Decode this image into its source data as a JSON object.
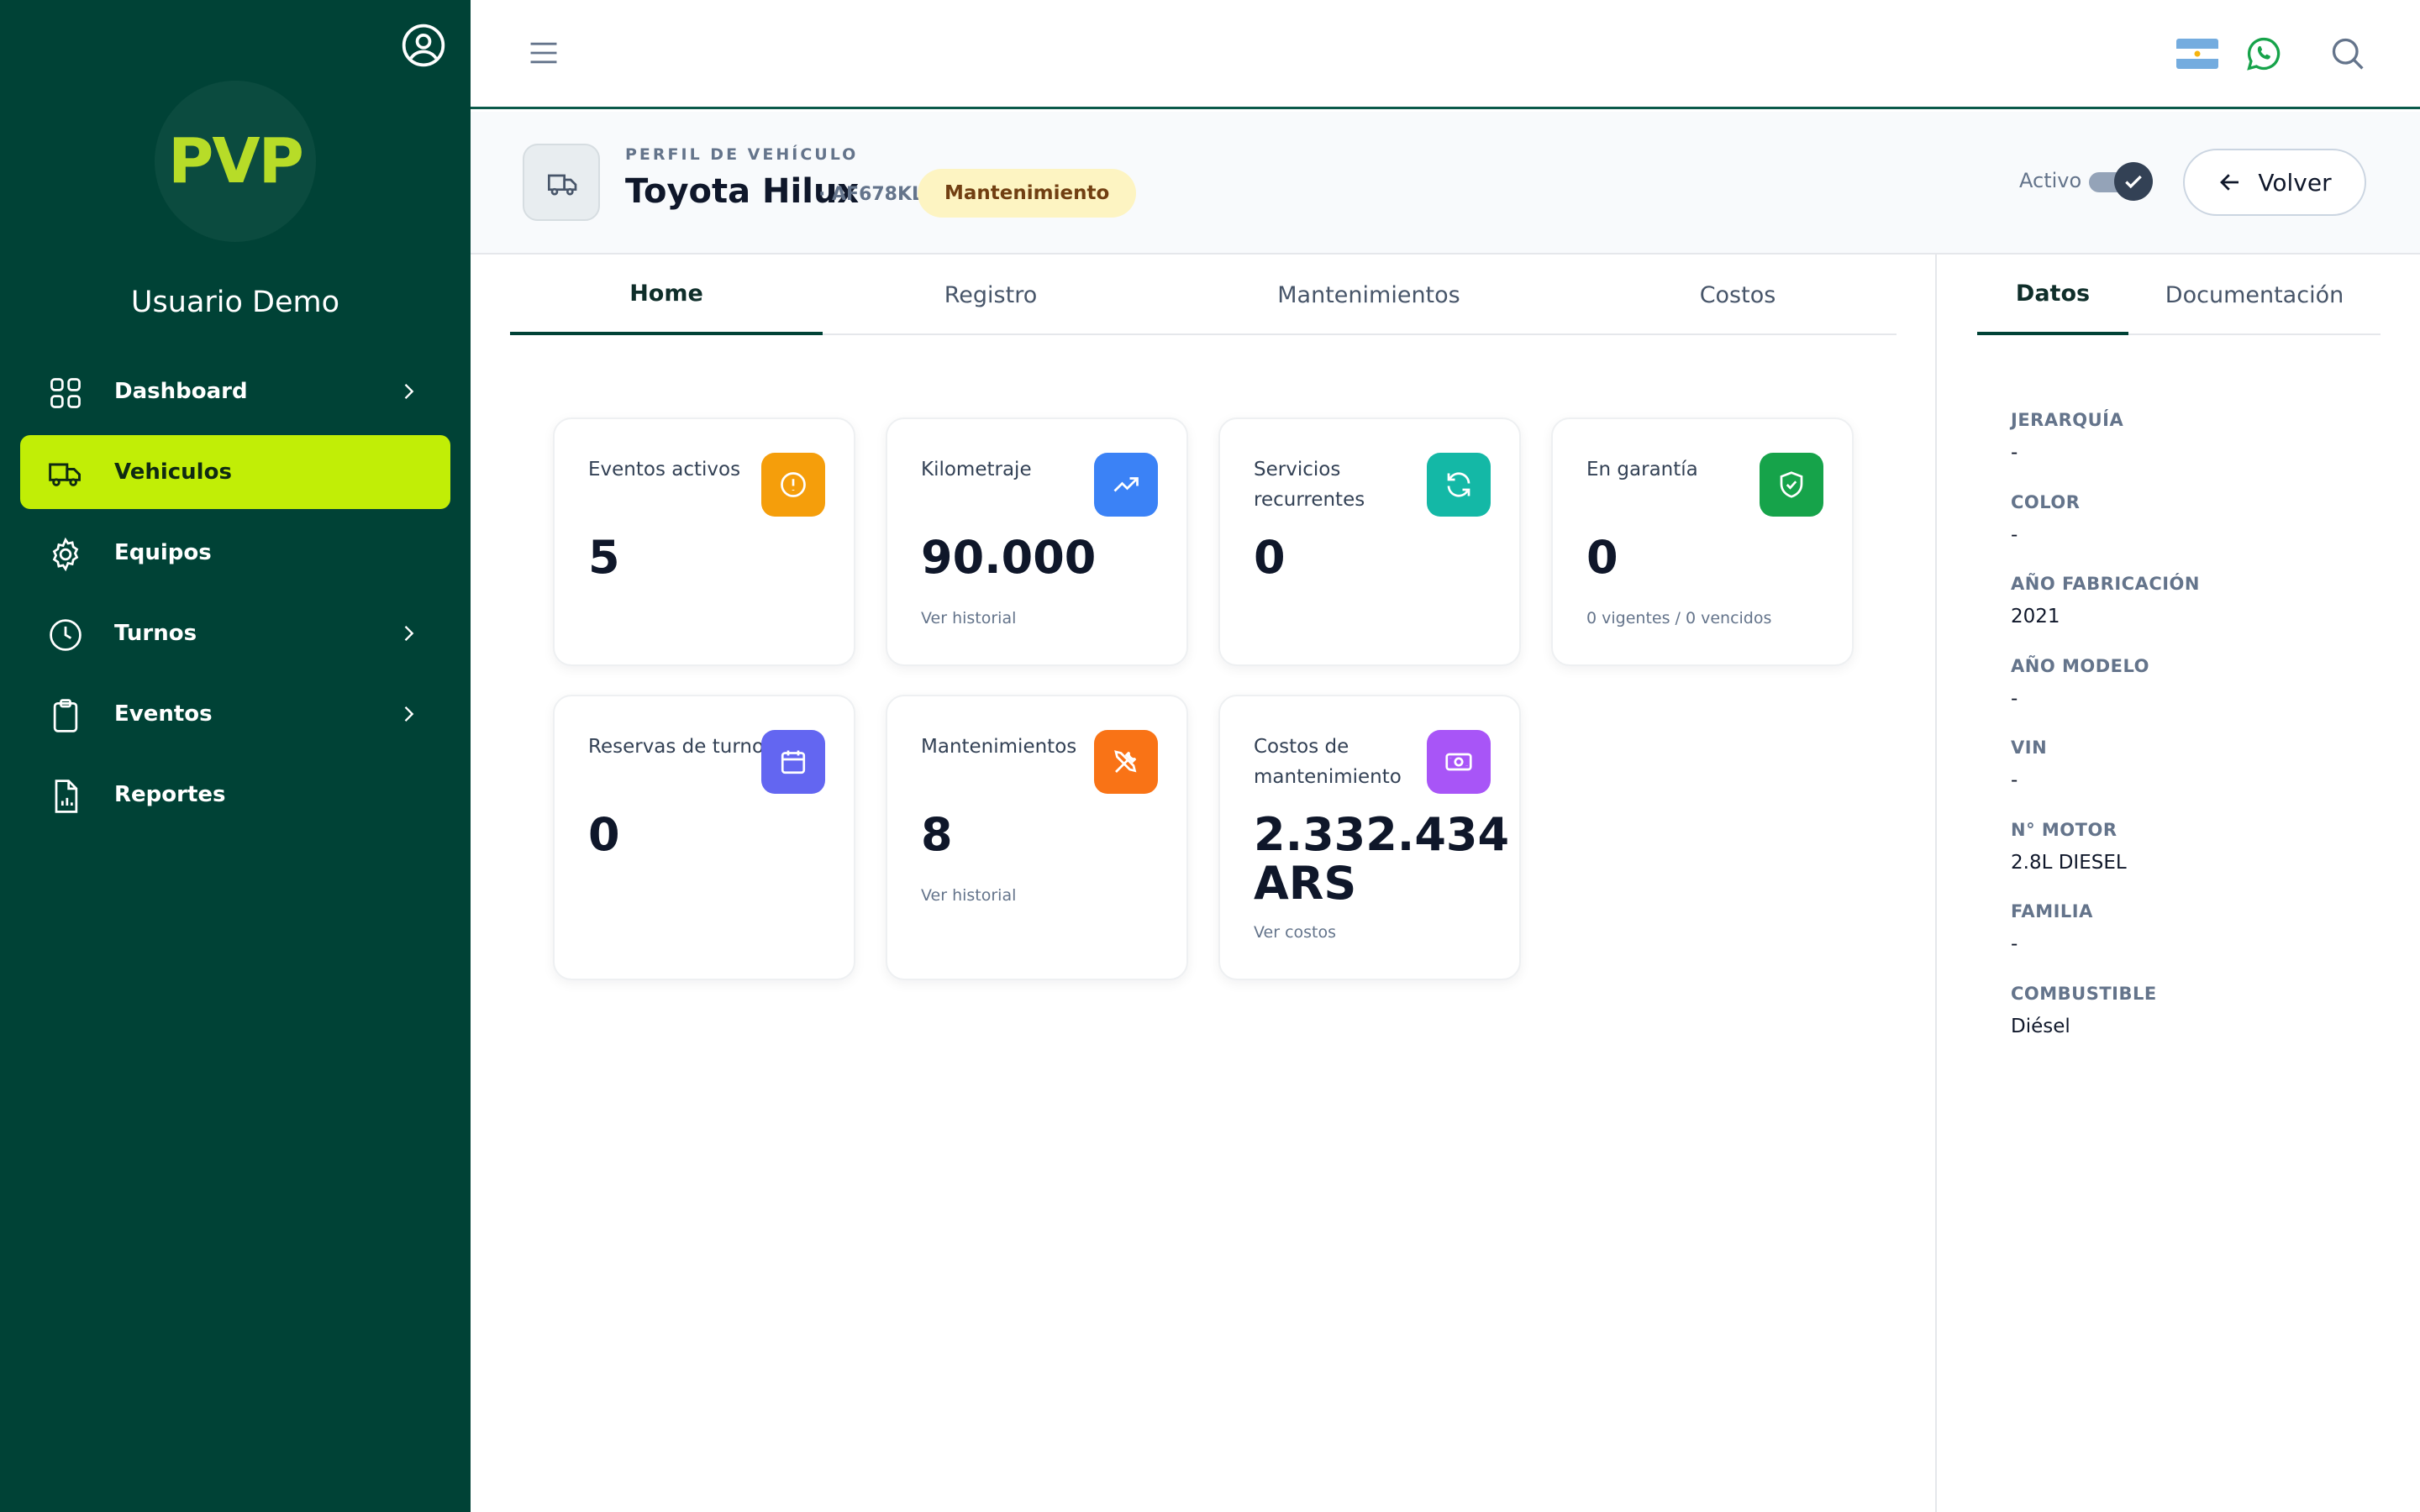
{
  "sidebar": {
    "username": "Usuario Demo",
    "logo": "PVP",
    "items": [
      {
        "label": "Dashboard",
        "icon": "grid-icon",
        "chevron": true,
        "active": false
      },
      {
        "label": "Vehiculos",
        "icon": "truck-icon",
        "chevron": false,
        "active": true
      },
      {
        "label": "Equipos",
        "icon": "gear-icon",
        "chevron": false,
        "active": false
      },
      {
        "label": "Turnos",
        "icon": "clock-icon",
        "chevron": true,
        "active": false
      },
      {
        "label": "Eventos",
        "icon": "clipboard-icon",
        "chevron": true,
        "active": false
      },
      {
        "label": "Reportes",
        "icon": "report-icon",
        "chevron": false,
        "active": false
      }
    ]
  },
  "header": {
    "eyebrow": "PERFIL DE VEHÍCULO",
    "vehicle_name": "Toyota Hilux",
    "plate": "· AF678KL",
    "status": "Mantenimiento",
    "active_label": "Activo",
    "active": true,
    "back_label": "Volver"
  },
  "tabs": [
    "Home",
    "Registro",
    "Mantenimientos",
    "Costos"
  ],
  "right_tabs": [
    "Datos",
    "Documentación"
  ],
  "cards": [
    {
      "title": "Eventos activos",
      "value": "5",
      "sub": "",
      "icon": "alert-icon",
      "color": "#f59e0b"
    },
    {
      "title": "Kilometraje",
      "value": "90.000",
      "sub": "Ver historial",
      "icon": "trending-up-icon",
      "color": "#3b82f6"
    },
    {
      "title": "Servicios recurrentes",
      "value": "0",
      "sub": "",
      "icon": "refresh-icon",
      "color": "#14b8a6"
    },
    {
      "title": "En garantía",
      "value": "0",
      "sub": "0 vigentes / 0 vencidos",
      "icon": "shield-check-icon",
      "color": "#16a34a"
    },
    {
      "title": "Reservas de turno",
      "value": "0",
      "sub": "",
      "icon": "calendar-icon",
      "color": "#6366f1"
    },
    {
      "title": "Mantenimientos",
      "value": "8",
      "sub": "Ver historial",
      "icon": "tools-icon",
      "color": "#f97316"
    },
    {
      "title": "Costos de mantenimiento",
      "value": "2.332.434 ARS",
      "sub": "Ver costos",
      "icon": "money-icon",
      "color": "#a855f7"
    }
  ],
  "details": [
    {
      "label": "JERARQUÍA",
      "value": "-"
    },
    {
      "label": "COLOR",
      "value": "-"
    },
    {
      "label": "AÑO FABRICACIÓN",
      "value": "2021"
    },
    {
      "label": "AÑO MODELO",
      "value": "-"
    },
    {
      "label": "VIN",
      "value": "-"
    },
    {
      "label": "N° MOTOR",
      "value": "2.8L DIESEL"
    },
    {
      "label": "FAMILIA",
      "value": "-"
    },
    {
      "label": "COMBUSTIBLE",
      "value": "Diésel"
    }
  ],
  "colors": {
    "sidebar": "#004236",
    "accent": "#c1ee06",
    "logo": "#b7dc28",
    "badge_bg": "#fdf4c2"
  }
}
